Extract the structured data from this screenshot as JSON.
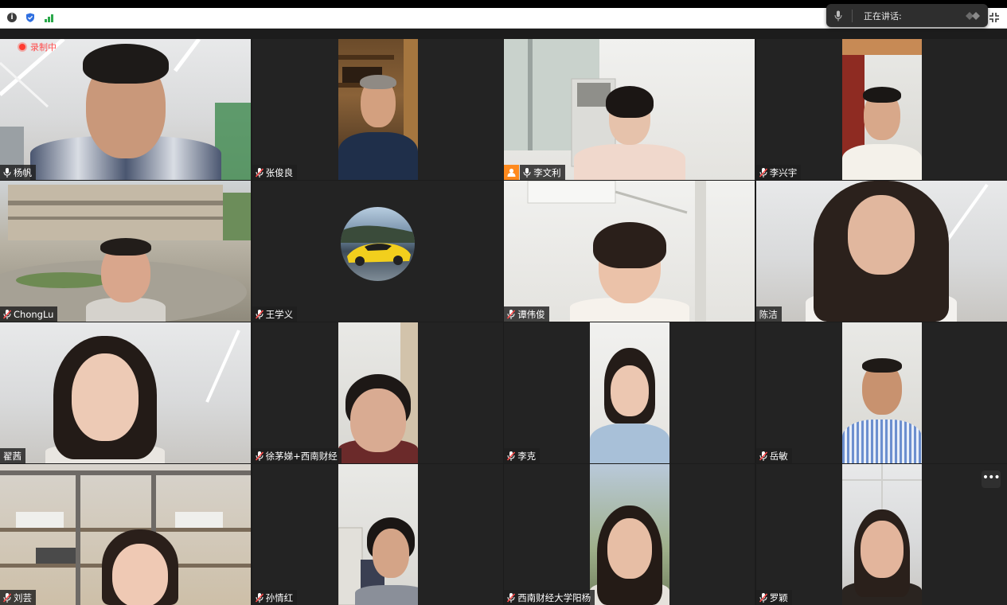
{
  "toolbar": {
    "icons": [
      "info-icon",
      "shield-icon",
      "signal-icon",
      "fullscreen-exit-icon"
    ]
  },
  "speaking": {
    "label": "正在讲话:"
  },
  "recording": {
    "label": "录制中"
  },
  "participants": [
    {
      "name": "杨帆"
    },
    {
      "name": "张俊良"
    },
    {
      "name": "李文利",
      "host": true
    },
    {
      "name": "李兴宇"
    },
    {
      "name": "ChongLu"
    },
    {
      "name": "王学义"
    },
    {
      "name": "谭伟俊"
    },
    {
      "name": "陈洁"
    },
    {
      "name": "翟茜"
    },
    {
      "name": "徐茅娣+西南财经"
    },
    {
      "name": "李克"
    },
    {
      "name": "岳敏"
    },
    {
      "name": "刘芸"
    },
    {
      "name": "孙情红"
    },
    {
      "name": "西南财经大学阳杨"
    },
    {
      "name": "罗颖"
    }
  ],
  "colors": {
    "recording": "#ff4d4d",
    "host_badge": "#ff8a1e",
    "signal": "#2aa84a",
    "shield": "#2f6fe0"
  }
}
